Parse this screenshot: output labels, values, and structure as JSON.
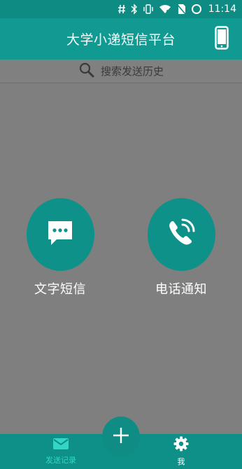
{
  "status_bar": {
    "time": "11:14",
    "icons": [
      "hash-icon",
      "bluetooth-icon",
      "vibrate-icon",
      "wifi-icon",
      "no-sim-icon",
      "battery-icon"
    ]
  },
  "header": {
    "title": "大学小递短信平台",
    "right_icon": "smartphone-icon"
  },
  "search": {
    "placeholder": "搜索发送历史",
    "icon": "search-icon"
  },
  "actions": [
    {
      "label": "文字短信",
      "icon": "chat-bubble-icon"
    },
    {
      "label": "电话通知",
      "icon": "phone-ringing-icon"
    }
  ],
  "bottom_nav": {
    "tabs": [
      {
        "label": "发送记录",
        "icon": "envelope-icon",
        "active": true
      },
      {
        "label": "我",
        "icon": "gear-icon",
        "active": false
      }
    ],
    "fab_icon": "plus-icon"
  },
  "colors": {
    "primary": "#119a92",
    "status_bar": "#0e8b83",
    "overlay": "#7f7f7f",
    "active_tab": "#33d6c6"
  }
}
